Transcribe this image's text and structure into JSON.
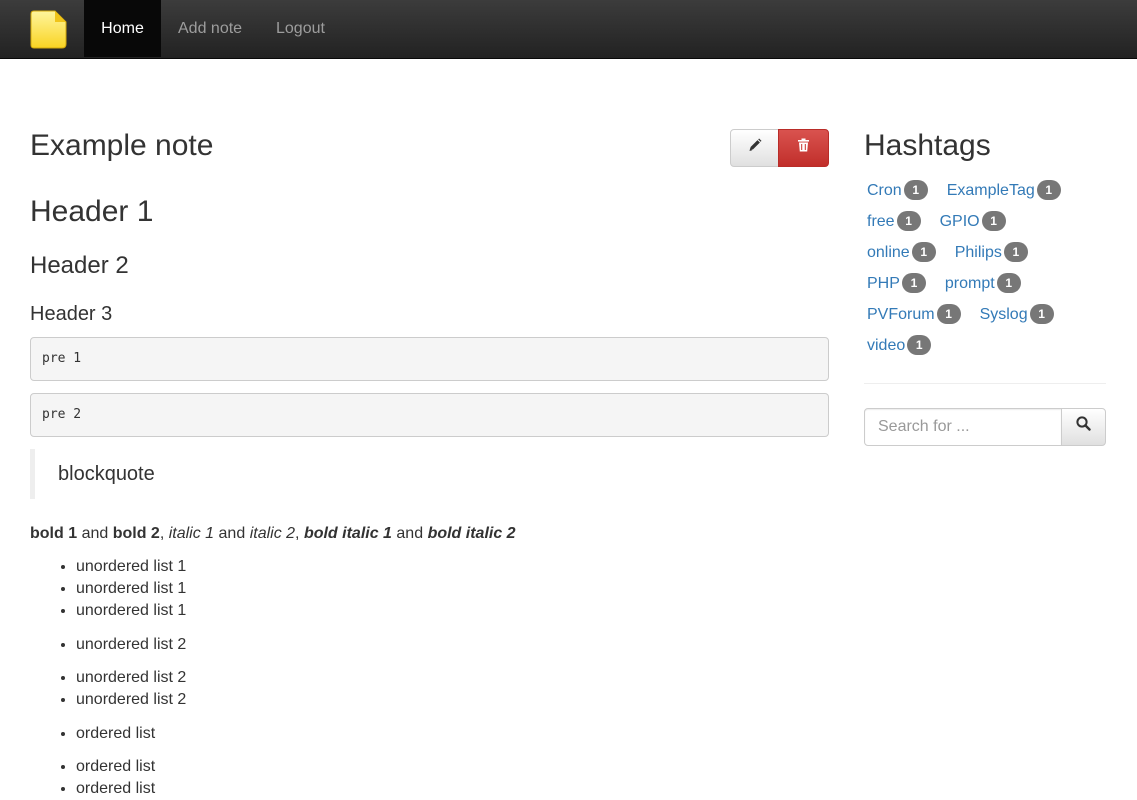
{
  "nav": {
    "logo_icon": "sticky-note-icon",
    "items": [
      {
        "label": "Home",
        "active": true
      },
      {
        "label": "Add note"
      },
      {
        "label": "Logout"
      }
    ]
  },
  "note": {
    "title": "Example note",
    "edit_icon": "pencil-icon",
    "delete_icon": "trash-icon",
    "header1": "Header 1",
    "header2": "Header 2",
    "header3": "Header 3",
    "pre1": "pre 1",
    "pre2": "pre 2",
    "blockquote": "blockquote",
    "para": {
      "bold1": "bold 1",
      "and1": "and",
      "bold2": "bold 2",
      "italic1": "italic 1",
      "and2": "and",
      "italic2": "italic 2",
      "bolditalic1": "bold italic 1",
      "and3": "and",
      "bolditalic2": "bold italic 2"
    },
    "lists": {
      "ul1": [
        "unordered list 1",
        "unordered list 1",
        "unordered list 1"
      ],
      "ul2": [
        "unordered list 2"
      ],
      "ul3": [
        "unordered list 2",
        "unordered list 2"
      ],
      "ol1": [
        "ordered list"
      ],
      "ol2": [
        "ordered list",
        "ordered list"
      ]
    }
  },
  "sidebar": {
    "title": "Hashtags",
    "tag_rows": [
      [
        {
          "name": "Cron",
          "count": "1"
        },
        {
          "name": "ExampleTag",
          "count": "1"
        }
      ],
      [
        {
          "name": "free",
          "count": "1"
        },
        {
          "name": "GPIO",
          "count": "1"
        }
      ],
      [
        {
          "name": "online",
          "count": "1"
        },
        {
          "name": "Philips",
          "count": "1"
        }
      ],
      [
        {
          "name": "PHP",
          "count": "1"
        },
        {
          "name": "prompt",
          "count": "1"
        }
      ],
      [
        {
          "name": "PVForum",
          "count": "1"
        },
        {
          "name": "Syslog",
          "count": "1"
        }
      ],
      [
        {
          "name": "video",
          "count": "1"
        }
      ]
    ],
    "search": {
      "placeholder": "Search for ...",
      "value": "",
      "icon": "search-icon"
    }
  },
  "colors": {
    "navbar": "#222222",
    "link": "#337ab7",
    "danger": "#d9534f",
    "badge": "#777777"
  }
}
